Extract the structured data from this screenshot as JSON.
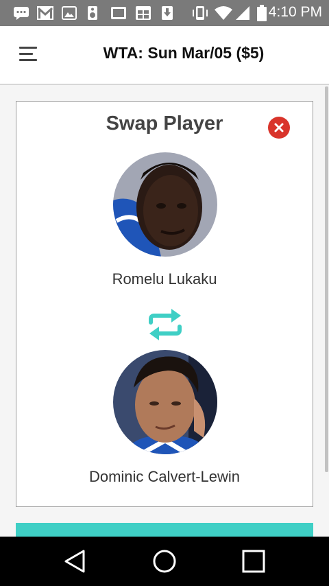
{
  "status_bar": {
    "time": "4:10 PM",
    "icons": [
      "message-icon",
      "gmail-icon",
      "image-icon",
      "speaker-icon",
      "screen-icon",
      "calendar-icon",
      "download-icon",
      "vibrate-icon",
      "wifi-icon",
      "signal-icon",
      "battery-icon"
    ]
  },
  "app_bar": {
    "title": "WTA: Sun Mar/05 ($5)",
    "menu_icon": "hamburger-menu-icon"
  },
  "dialog": {
    "title": "Swap Player",
    "close_icon": "close-icon",
    "player_out": {
      "name": "Romelu Lukaku"
    },
    "swap_icon": "swap-arrows-icon",
    "player_in": {
      "name": "Dominic Calvert-Lewin"
    }
  },
  "colors": {
    "accent": "#3fcfc5",
    "close": "#d9342b",
    "status_bar": "#7a7a7a",
    "jersey_blue": "#1f55b8"
  },
  "nav_bar": {
    "icons": [
      "back-icon",
      "home-icon",
      "recents-icon"
    ]
  }
}
